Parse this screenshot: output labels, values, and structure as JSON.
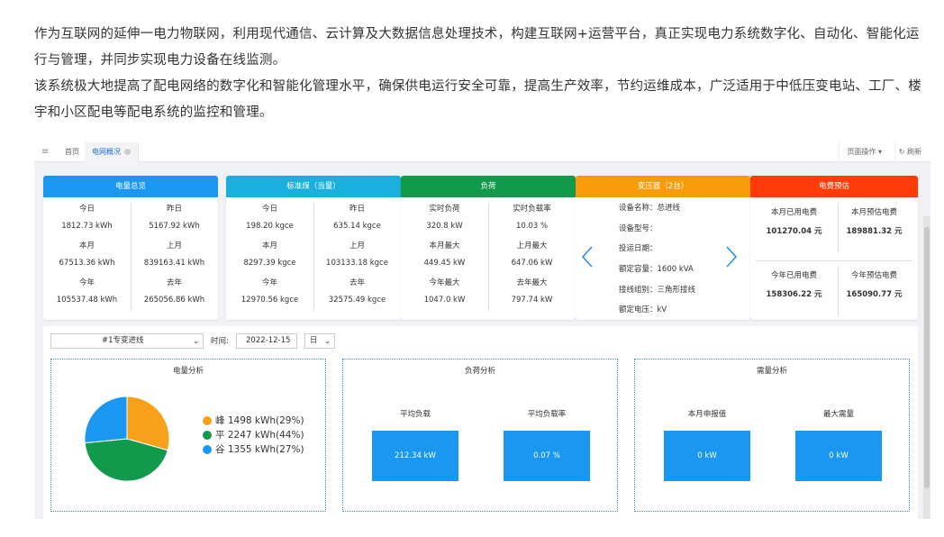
{
  "intro": {
    "p1": "作为互联网的延伸一电力物联网，利用现代通信、云计算及大数据信息处理技术，构建互联网+运营平台，真正实现电力系统数字化、自动化、智能化运行与管理，并同步实现电力设备在线监测。",
    "p2": "该系统极大地提高了配电网络的数字化和智能化管理水平，确保供电运行安全可靠，提高生产效率，节约运维成本，广泛适用于中低压变电站、工厂、楼宇和小区配电等配电系统的监控和管理。"
  },
  "topbar": {
    "home": "首页",
    "tab": "电网概况",
    "ops": "页面操作",
    "refresh": "刷新"
  },
  "colors": {
    "energy": "#1a97f0",
    "coal": "#19b0dd",
    "load": "#129a4c",
    "transformer": "#f99c0c",
    "bill": "#ff3b08"
  },
  "cards": {
    "energy": {
      "title": "电量总览",
      "cells": [
        {
          "label": "今日",
          "value": "1812.73 kWh"
        },
        {
          "label": "昨日",
          "value": "5167.92 kWh"
        },
        {
          "label": "本月",
          "value": "67513.36 kWh"
        },
        {
          "label": "上月",
          "value": "839163.41 kWh"
        },
        {
          "label": "今年",
          "value": "105537.48 kWh"
        },
        {
          "label": "去年",
          "value": "265056.86 kWh"
        }
      ]
    },
    "coal": {
      "title": "标准煤（当量）",
      "cells": [
        {
          "label": "今日",
          "value": "198.20 kgce"
        },
        {
          "label": "昨日",
          "value": "635.14 kgce"
        },
        {
          "label": "本月",
          "value": "8297.39 kgce"
        },
        {
          "label": "上月",
          "value": "103133.18 kgce"
        },
        {
          "label": "今年",
          "value": "12970.56 kgce"
        },
        {
          "label": "去年",
          "value": "32575.49 kgce"
        }
      ]
    },
    "load": {
      "title": "负荷",
      "cells": [
        {
          "label": "实时负荷",
          "value": "320.8 kW"
        },
        {
          "label": "实时负载率",
          "value": "10.03 %"
        },
        {
          "label": "本月最大",
          "value": "449.45 kW"
        },
        {
          "label": "上月最大",
          "value": "647.06 kW"
        },
        {
          "label": "今年最大",
          "value": "1047.0 kW"
        },
        {
          "label": "去年最大",
          "value": "797.74 kW"
        }
      ]
    },
    "transformer": {
      "title": "变压器（2台）",
      "rows": [
        "设备名称：总进线",
        "设备型号：",
        "投运日期：",
        "额定容量：1600 kVA",
        "接线组别：三角形接线",
        "额定电压：kV"
      ]
    },
    "bill": {
      "title": "电费预估",
      "cells": [
        {
          "label": "本月已用电费",
          "value": "101270.04 元"
        },
        {
          "label": "本月预估电费",
          "value": "189881.32 元"
        },
        {
          "label": "今年已用电费",
          "value": "158306.22 元"
        },
        {
          "label": "今年预估电费",
          "value": "165090.77 元"
        }
      ]
    }
  },
  "filter": {
    "line": "#1专变进线",
    "time_label": "时间:",
    "date": "2022-12-15",
    "period": "日"
  },
  "energy_analysis": {
    "title": "电量分析",
    "legend": [
      "峰 1498 kWh(29%)",
      "平 2247 kWh(44%)",
      "谷 1355 kWh(27%)"
    ]
  },
  "chart_data": {
    "type": "pie",
    "title": "电量分析",
    "categories": [
      "峰",
      "平",
      "谷"
    ],
    "values": [
      1498,
      2247,
      1355
    ],
    "percent": [
      29,
      44,
      27
    ],
    "unit": "kWh",
    "colors": [
      "#f7a11a",
      "#129a4c",
      "#1a97f0"
    ],
    "legend_position": "right"
  },
  "load_analysis": {
    "title": "负荷分析",
    "avg_load_label": "平均负载",
    "avg_load_value": "212.34 kW",
    "avg_rate_label": "平均负载率",
    "avg_rate_value": "0.07 %"
  },
  "demand_analysis": {
    "title": "需量分析",
    "declared_label": "本月申报值",
    "declared_value": "0 kW",
    "max_label": "最大需量",
    "max_value": "0 kW"
  }
}
